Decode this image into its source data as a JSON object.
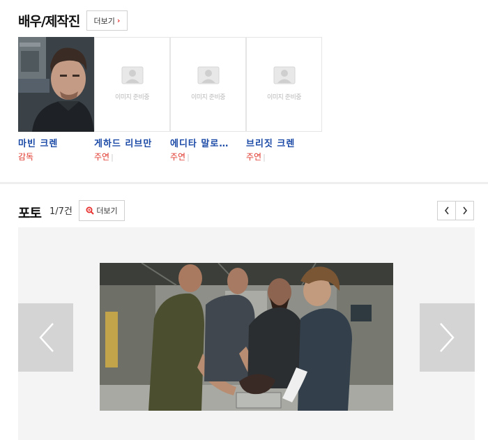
{
  "cast_section": {
    "title": "배우/제작진",
    "more_label": "더보기",
    "members": [
      {
        "name": "마빈 크렌",
        "role": "감독",
        "has_photo": true
      },
      {
        "name": "게하드 리브만",
        "role": "주연",
        "has_photo": false,
        "placeholder": "이미지 준비중"
      },
      {
        "name": "에디타 말로…",
        "role": "주연",
        "has_photo": false,
        "placeholder": "이미지 준비중"
      },
      {
        "name": "브리짓 크렌",
        "role": "주연",
        "has_photo": false,
        "placeholder": "이미지 준비중"
      }
    ]
  },
  "photo_section": {
    "title": "포토",
    "counter": "1/7건",
    "more_label": "더보기"
  },
  "colors": {
    "name_link": "#1a49a6",
    "role_text": "#e0392f",
    "accent_red": "#e8312f",
    "viewer_bg": "#f4f4f4",
    "arrow_bg": "#d4d4d4"
  },
  "icons": [
    "chevron-right-icon",
    "zoom-icon",
    "chevron-left-icon",
    "image-placeholder-icon"
  ]
}
